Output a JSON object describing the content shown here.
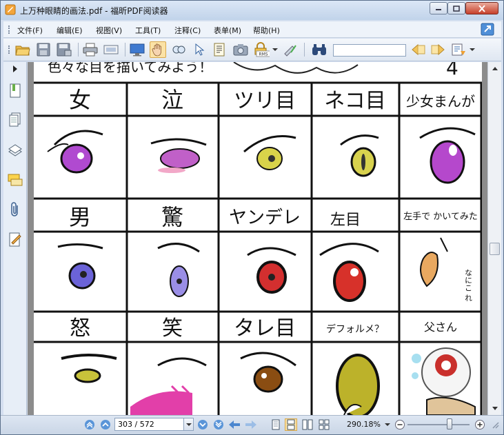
{
  "window": {
    "title": "上万种眼睛的画法.pdf - 福昕PDF阅读器"
  },
  "menu": {
    "items": [
      {
        "label": "文件(F)"
      },
      {
        "label": "编辑(E)"
      },
      {
        "label": "视图(V)"
      },
      {
        "label": "工具(T)"
      },
      {
        "label": "注释(C)"
      },
      {
        "label": "表单(M)"
      },
      {
        "label": "帮助(H)"
      }
    ]
  },
  "toolbar": {
    "buttons": [
      "open-icon",
      "save-icon",
      "save-as-icon",
      "print-icon",
      "scan-icon",
      "full-screen-icon",
      "hand-tool-icon",
      "zoom-tool-icon",
      "select-tool-icon",
      "text-select-icon",
      "snapshot-icon",
      "rms-protect-icon",
      "sign-icon"
    ],
    "rms_label": "RMS",
    "search": {
      "value": ""
    }
  },
  "document": {
    "header_text": "色々な目を描いてみよう！",
    "rows": [
      {
        "labels": [
          "女",
          "泣",
          "ツリ目",
          "ネコ目",
          "少女まんが"
        ]
      },
      {
        "labels": [
          "男",
          "驚",
          "ヤンデレ",
          "左目",
          "左手で かいてみた"
        ]
      },
      {
        "labels": [
          "怒",
          "笑",
          "タレ目",
          "デフォルメ？",
          "父さん"
        ]
      }
    ],
    "side_note": "なにこ れ"
  },
  "status": {
    "page_display": "303 / 572",
    "zoom": "290.18%"
  },
  "colors": {
    "accent": "#3a6fb0",
    "titlebar_top": "#dbe7f6",
    "viewer_bg": "#8c8c8c"
  }
}
